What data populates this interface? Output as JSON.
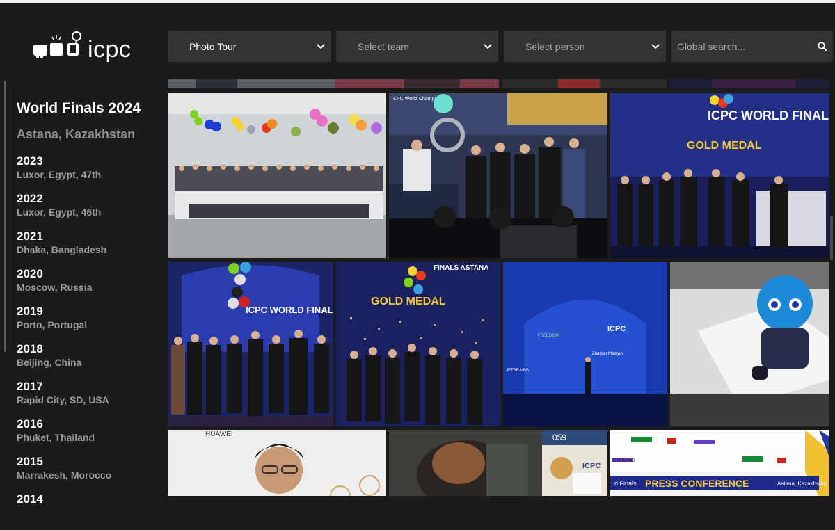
{
  "header": {
    "logo_text": "icpc",
    "dropdowns": [
      {
        "label": "Photo Tour",
        "is_placeholder": false
      },
      {
        "label": "Select team",
        "is_placeholder": true
      },
      {
        "label": "Select person",
        "is_placeholder": true
      }
    ],
    "search": {
      "placeholder": "Global search..."
    }
  },
  "sidebar": {
    "title": "World Finals 2024",
    "subtitle": "Astana, Kazakhstan",
    "years": [
      {
        "year": "2023",
        "location": "Luxor, Egypt, 47th"
      },
      {
        "year": "2022",
        "location": "Luxor, Egypt, 46th"
      },
      {
        "year": "2021",
        "location": "Dhaka, Bangladesh"
      },
      {
        "year": "2020",
        "location": "Moscow, Russia"
      },
      {
        "year": "2019",
        "location": "Porto, Portugal"
      },
      {
        "year": "2018",
        "location": "Beijing, China"
      },
      {
        "year": "2017",
        "location": "Rapid City, SD, USA"
      },
      {
        "year": "2016",
        "location": "Phuket, Thailand"
      },
      {
        "year": "2015",
        "location": "Marrakesh, Morocco"
      },
      {
        "year": "2014",
        "location": ""
      }
    ]
  },
  "gallery": {
    "photos": [
      {
        "caption": "CPC World Champions"
      },
      {
        "caption": "ICPC WORLD FINALS ASTANA"
      },
      {
        "caption": "GOLD MEDAL"
      },
      {
        "caption": "ICPC WORLD FINALS ASTANA"
      },
      {
        "caption": "FINALS ASTANA"
      },
      {
        "caption": "GOLD MEDAL"
      },
      {
        "caption": "ICPC"
      },
      {
        "caption": "Zhaslan Madiyev"
      },
      {
        "caption": "JETBRAINS"
      },
      {
        "caption": "FREEDOM"
      },
      {
        "caption": "HUAWEI"
      },
      {
        "caption": "059"
      },
      {
        "caption": "ICPC"
      },
      {
        "caption": "PRESS CONFERENCE"
      },
      {
        "caption": "Astana, Kazakhstan"
      },
      {
        "caption": "d Finals"
      }
    ]
  }
}
